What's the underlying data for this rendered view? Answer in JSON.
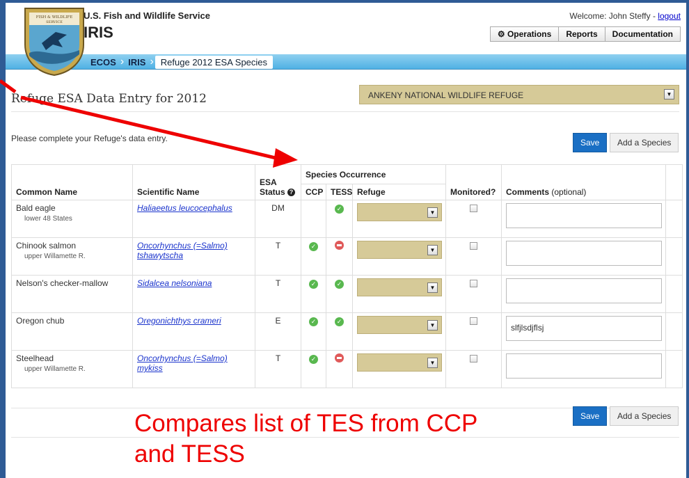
{
  "header": {
    "site_name": "U.S. Fish and Wildlife Service",
    "app_name": "IRIS",
    "welcome_text": "Welcome: John Steffy - ",
    "logout_label": "logout",
    "nav": [
      {
        "label": "Operations",
        "icon": "gear-icon"
      },
      {
        "label": "Reports"
      },
      {
        "label": "Documentation"
      }
    ]
  },
  "breadcrumb": {
    "items": [
      "ECOS",
      "IRIS",
      "Refuge 2012 ESA Species"
    ]
  },
  "page": {
    "title": "Refuge ESA Data Entry for 2012",
    "refuge_selected": "ANKENY NATIONAL WILDLIFE REFUGE",
    "instruction": "Please complete your Refuge's data entry.",
    "save_label": "Save",
    "add_label": "Add a Species"
  },
  "table": {
    "headers": {
      "common": "Common Name",
      "scientific": "Scientific Name",
      "esa_top": "ESA",
      "esa_bottom": "Status",
      "occurrence": "Species Occurrence",
      "ccp": "CCP",
      "tess": "TESS",
      "refuge": "Refuge",
      "monitored": "Monitored?",
      "comments": "Comments",
      "comments_note": "(optional)"
    },
    "rows": [
      {
        "common": "Bald eagle",
        "sub": "lower 48 States",
        "sci": "Haliaeetus leucocephalus",
        "status": "DM",
        "ccp": "",
        "tess": "yes",
        "comment": ""
      },
      {
        "common": "Chinook salmon",
        "sub": "upper Willamette R.",
        "sci": "Oncorhynchus (=Salmo) tshawytscha",
        "status": "T",
        "ccp": "yes",
        "tess": "no",
        "comment": ""
      },
      {
        "common": "Nelson's checker-mallow",
        "sub": "",
        "sci": "Sidalcea nelsoniana",
        "status": "T",
        "ccp": "yes",
        "tess": "yes",
        "comment": ""
      },
      {
        "common": "Oregon chub",
        "sub": "",
        "sci": "Oregonichthys crameri",
        "status": "E",
        "ccp": "yes",
        "tess": "yes",
        "comment": "slfjlsdjflsj"
      },
      {
        "common": "Steelhead",
        "sub": "upper Willamette R.",
        "sci": "Oncorhynchus (=Salmo) mykiss",
        "status": "T",
        "ccp": "yes",
        "tess": "no",
        "comment": ""
      }
    ]
  },
  "annotation": {
    "line1": "Compares list of TES from CCP",
    "line2": "and TESS",
    "color": "#ee0000"
  },
  "colors": {
    "accent": "#1a6fc4",
    "frame": "#2f5b95",
    "select_bg": "#d6ca98",
    "ok": "#59b84f",
    "no": "#e05a5a"
  }
}
